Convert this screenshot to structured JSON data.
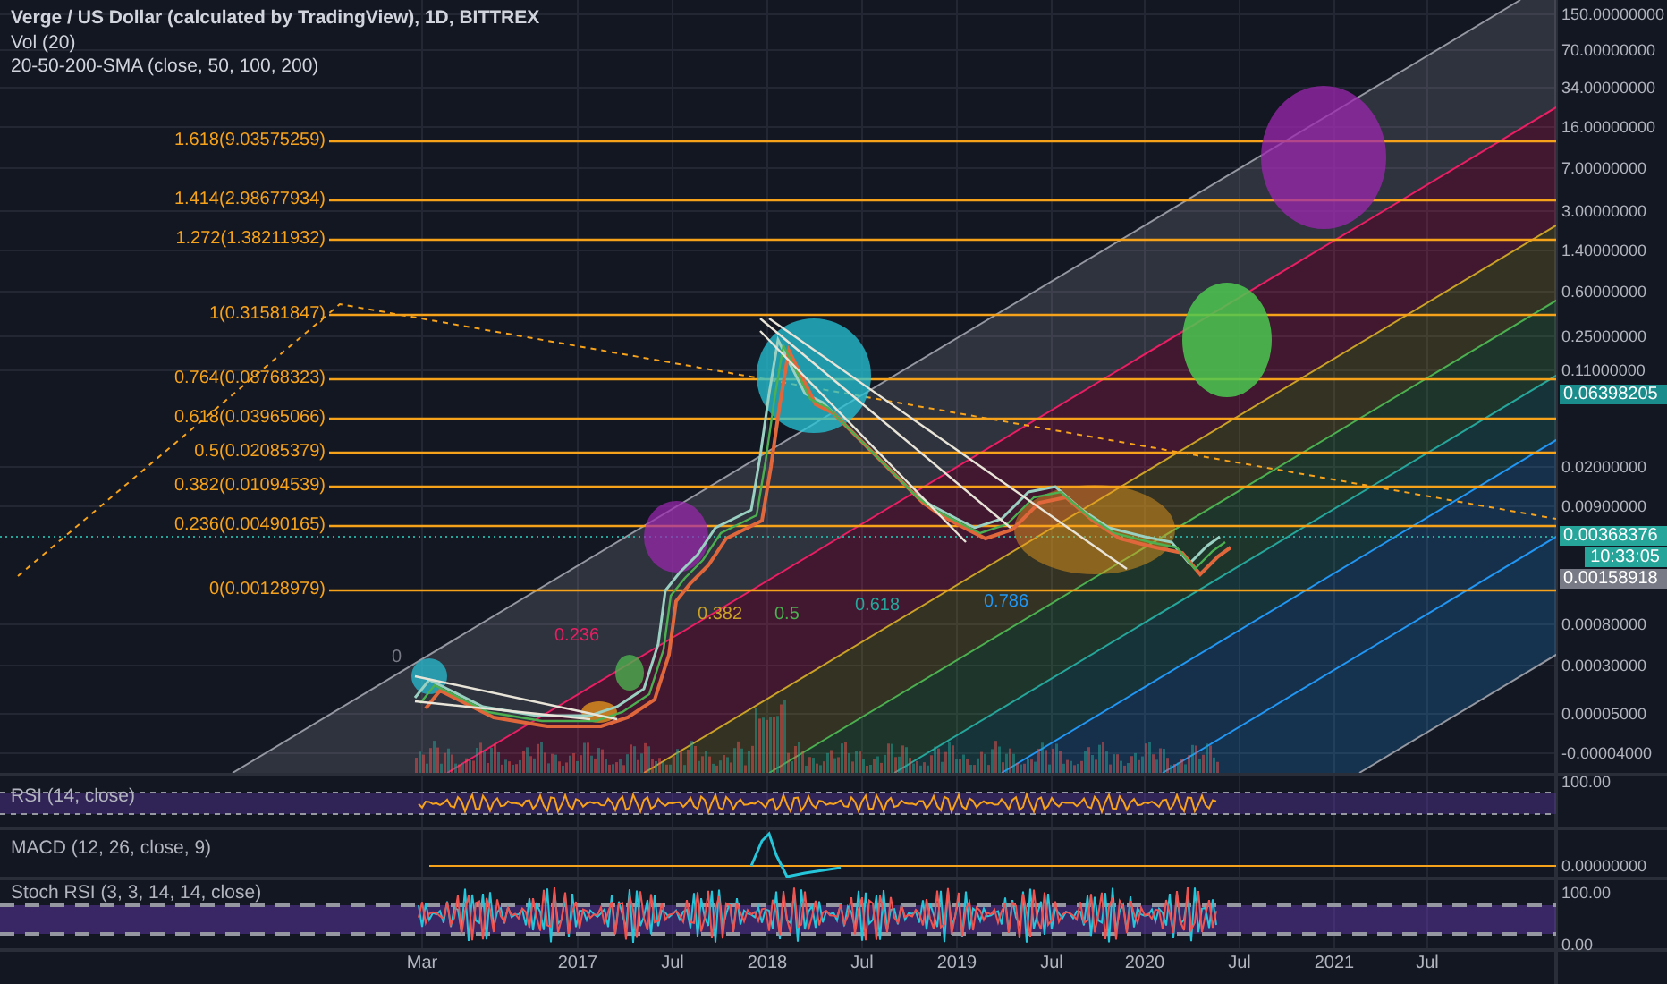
{
  "chart": {
    "title": "Verge / US Dollar (calculated by TradingView), 1D, BITTREX",
    "indicators": [
      "Vol (20)",
      "20-50-200-SMA (close, 50, 100, 200)"
    ],
    "price_axis": [
      "150.00000000",
      "70.00000000",
      "34.00000000",
      "16.00000000",
      "7.00000000",
      "3.00000000",
      "1.40000000",
      "0.60000000",
      "0.25000000",
      "0.11000000",
      "0.02000000",
      "0.00900000",
      "0.00080000",
      "0.00030000",
      "0.00005000",
      "-0.00004000"
    ],
    "price_badges": [
      {
        "text": "0.06398205",
        "kind": "line"
      },
      {
        "text": "0.00368376",
        "kind": "last"
      },
      {
        "text": "10:33:05",
        "kind": "countdown"
      },
      {
        "text": "0.00158918",
        "kind": "low"
      }
    ],
    "fib_levels": [
      "1.618(9.03575259)",
      "1.414(2.98677934)",
      "1.272(1.38211932)",
      "1(0.31581847)",
      "0.764(0.08768323)",
      "0.618(0.03965066)",
      "0.5(0.02085379)",
      "0.382(0.01094539)",
      "0.236(0.00490165)",
      "0(0.00128979)"
    ],
    "channel_labels": [
      {
        "text": "0",
        "color": "#787b86"
      },
      {
        "text": "0.236",
        "color": "#e91e63"
      },
      {
        "text": "0.382",
        "color": "#c9a227"
      },
      {
        "text": "0.5",
        "color": "#4caf50"
      },
      {
        "text": "0.618",
        "color": "#26a69a"
      },
      {
        "text": "0.786",
        "color": "#2196f3"
      }
    ]
  },
  "panes": [
    {
      "label": "RSI (14, close)",
      "axis": [
        "100.00"
      ]
    },
    {
      "label": "MACD (12, 26, close, 9)",
      "axis": [
        "0.00000000"
      ]
    },
    {
      "label": "Stoch RSI (3, 3, 14, 14, close)",
      "axis": [
        "100.00",
        "0.00"
      ]
    }
  ],
  "time_axis": [
    "Mar",
    "2017",
    "Jul",
    "2018",
    "Jul",
    "2019",
    "Jul",
    "2020",
    "Jul",
    "2021",
    "Jul"
  ]
}
